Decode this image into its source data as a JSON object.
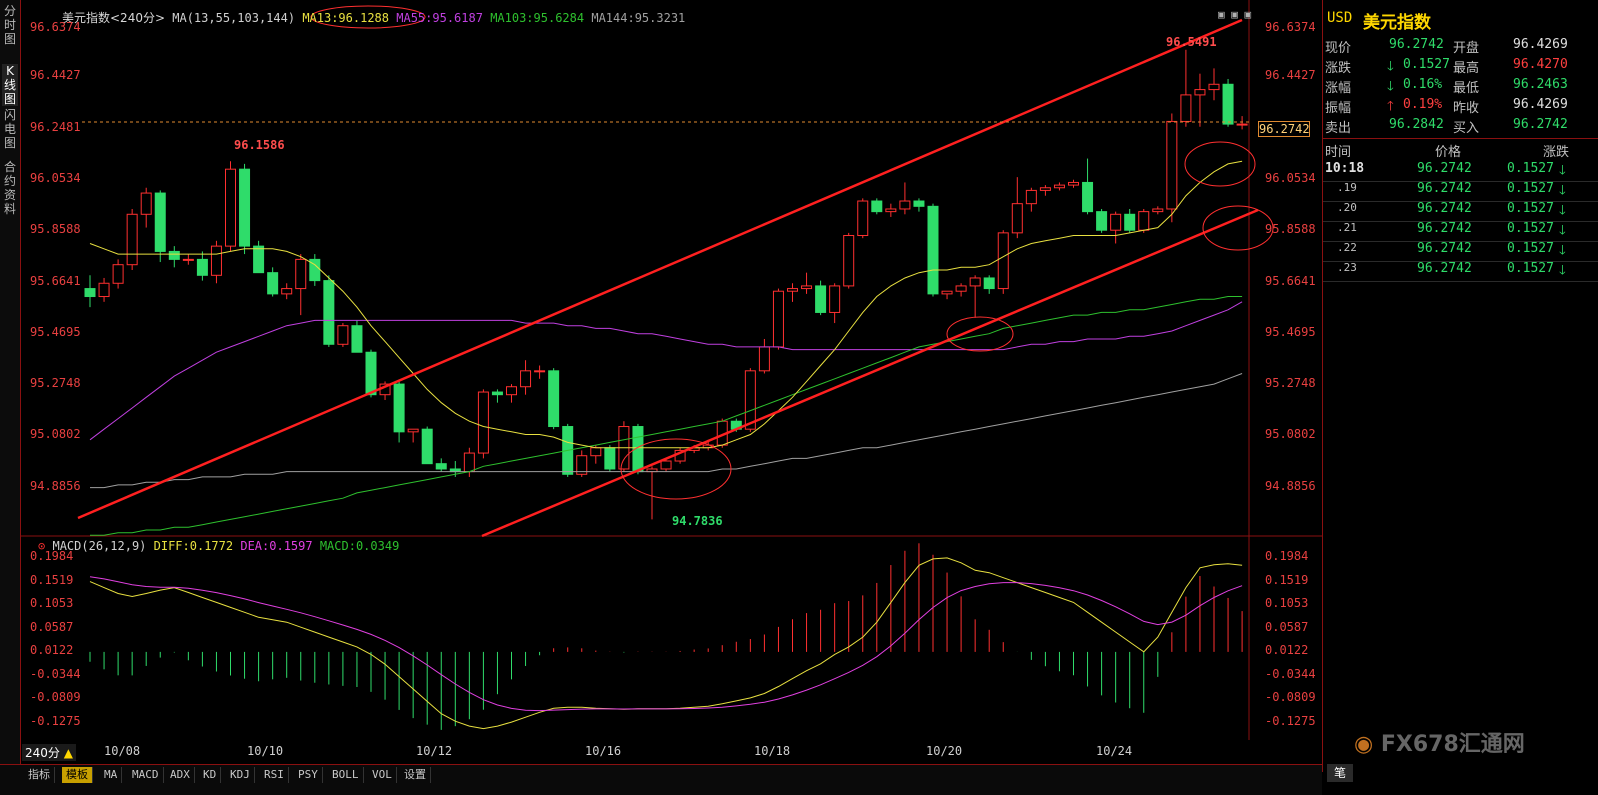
{
  "leftbar": {
    "tabs": [
      {
        "label": "分时图",
        "active": false
      },
      {
        "label": "K线图",
        "active": true
      },
      {
        "label": "闪电图",
        "active": false
      },
      {
        "label": "合约资料",
        "active": false
      }
    ]
  },
  "main_legend": {
    "title": "美元指数<240分>",
    "ma_params": "MA(13,55,103,144)",
    "ma13": "MA13:96.1288",
    "ma55": "MA55:95.6187",
    "ma103": "MA103:95.6284",
    "ma144": "MA144:95.3231"
  },
  "macd_legend": {
    "params": "MACD(26,12,9)",
    "diff": "DIFF:0.1772",
    "dea": "DEA:0.1597",
    "macd": "MACD:0.0349"
  },
  "price_axis": [
    "96.6374",
    "96.4427",
    "96.2481",
    "96.0534",
    "95.8588",
    "95.6641",
    "95.4695",
    "95.2748",
    "95.0802",
    "94.8856"
  ],
  "macd_axis": [
    "0.1984",
    "0.1519",
    "0.1053",
    "0.0587",
    "0.0122",
    "-0.0344",
    "-0.0809",
    "-0.1275"
  ],
  "x_axis": [
    "10/08",
    "10/10",
    "10/12",
    "10/16",
    "10/18",
    "10/20",
    "10/24"
  ],
  "annotations": {
    "high_label": "96.5491",
    "left_high_label": "96.1586",
    "low_label": "94.7836",
    "current_price_tag": "96.2742"
  },
  "period_selector": "240分",
  "bottom_tabs": [
    "指标",
    "模板",
    "MA",
    "MACD",
    "ADX",
    "KD",
    "KDJ",
    "RSI",
    "PSY",
    "BOLL",
    "VOL",
    "设置"
  ],
  "quote_panel": {
    "symbol": "USD",
    "name": "美元指数",
    "rows": [
      {
        "l1": "现价",
        "v1": "96.2742",
        "l2": "开盘",
        "v2": "96.4269"
      },
      {
        "l1": "涨跌",
        "v1": "0.1527",
        "l2": "最高",
        "v2": "96.4270"
      },
      {
        "l1": "涨幅",
        "v1": "0.16%",
        "l2": "最低",
        "v2": "96.2463"
      },
      {
        "l1": "振幅",
        "v1": "0.19%",
        "l2": "昨收",
        "v2": "96.4269"
      },
      {
        "l1": "卖出",
        "v1": "96.2842",
        "l2": "买入",
        "v2": "96.2742"
      }
    ],
    "ticks_header": {
      "time": "时间",
      "price": "价格",
      "change": "涨跌"
    },
    "ticks": [
      {
        "time": "10:18",
        "price": "96.2742",
        "change": "0.1527"
      },
      {
        "time": ".19",
        "price": "96.2742",
        "change": "0.1527"
      },
      {
        "time": ".20",
        "price": "96.2742",
        "change": "0.1527"
      },
      {
        "time": ".21",
        "price": "96.2742",
        "change": "0.1527"
      },
      {
        "time": ".22",
        "price": "96.2742",
        "change": "0.1527"
      },
      {
        "time": ".23",
        "price": "96.2742",
        "change": "0.1527"
      }
    ],
    "bottom_tab": "笔"
  },
  "watermark": "FX678汇通网",
  "colors": {
    "up": "#ff3030",
    "down": "#2fdc6a",
    "ma13": "#e8e040",
    "ma55": "#2ec02e",
    "ma103": "#c040e0",
    "ma144": "#a0a0a0",
    "trend": "#ff2020"
  },
  "chart_data": {
    "type": "candlestick",
    "ylim": [
      94.74,
      96.7
    ],
    "candles": [
      [
        95.65,
        95.7,
        95.58,
        95.62
      ],
      [
        95.62,
        95.69,
        95.6,
        95.67
      ],
      [
        95.67,
        95.76,
        95.65,
        95.74
      ],
      [
        95.74,
        95.95,
        95.72,
        95.93
      ],
      [
        95.93,
        96.03,
        95.88,
        96.01
      ],
      [
        96.01,
        96.02,
        95.75,
        95.79
      ],
      [
        95.79,
        95.81,
        95.73,
        95.76
      ],
      [
        95.76,
        95.78,
        95.74,
        95.76
      ],
      [
        95.76,
        95.79,
        95.68,
        95.7
      ],
      [
        95.7,
        95.83,
        95.67,
        95.81
      ],
      [
        95.81,
        96.13,
        95.79,
        96.1
      ],
      [
        96.1,
        96.12,
        95.78,
        95.81
      ],
      [
        95.81,
        95.83,
        95.71,
        95.71
      ],
      [
        95.71,
        95.73,
        95.62,
        95.63
      ],
      [
        95.63,
        95.67,
        95.61,
        95.65
      ],
      [
        95.65,
        95.78,
        95.55,
        95.76
      ],
      [
        95.76,
        95.78,
        95.66,
        95.68
      ],
      [
        95.68,
        95.7,
        95.43,
        95.44
      ],
      [
        95.44,
        95.52,
        95.43,
        95.51
      ],
      [
        95.51,
        95.53,
        95.41,
        95.41
      ],
      [
        95.41,
        95.42,
        95.24,
        95.25
      ],
      [
        95.25,
        95.3,
        95.23,
        95.29
      ],
      [
        95.29,
        95.3,
        95.07,
        95.11
      ],
      [
        95.11,
        95.12,
        95.07,
        95.12
      ],
      [
        95.12,
        95.13,
        94.99,
        94.99
      ],
      [
        94.99,
        95.01,
        94.96,
        94.97
      ],
      [
        94.97,
        95.0,
        94.94,
        94.96
      ],
      [
        94.96,
        95.05,
        94.94,
        95.03
      ],
      [
        95.03,
        95.27,
        95.01,
        95.26
      ],
      [
        95.26,
        95.27,
        95.22,
        95.25
      ],
      [
        95.25,
        95.29,
        95.22,
        95.28
      ],
      [
        95.28,
        95.38,
        95.25,
        95.34
      ],
      [
        95.34,
        95.36,
        95.31,
        95.34
      ],
      [
        95.34,
        95.35,
        95.12,
        95.13
      ],
      [
        95.13,
        95.14,
        94.94,
        94.95
      ],
      [
        94.95,
        95.04,
        94.94,
        95.02
      ],
      [
        95.02,
        95.06,
        94.99,
        95.05
      ],
      [
        95.05,
        95.06,
        94.96,
        94.97
      ],
      [
        94.97,
        95.15,
        94.96,
        95.13
      ],
      [
        95.13,
        95.14,
        94.95,
        94.96
      ],
      [
        94.96,
        94.98,
        94.78,
        94.97
      ],
      [
        94.97,
        95.01,
        94.96,
        95.0
      ],
      [
        95.0,
        95.05,
        94.99,
        95.04
      ],
      [
        95.04,
        95.06,
        95.03,
        95.05
      ],
      [
        95.05,
        95.08,
        95.04,
        95.06
      ],
      [
        95.06,
        95.16,
        95.05,
        95.15
      ],
      [
        95.15,
        95.16,
        95.11,
        95.12
      ],
      [
        95.12,
        95.35,
        95.11,
        95.34
      ],
      [
        95.34,
        95.46,
        95.33,
        95.43
      ],
      [
        95.43,
        95.65,
        95.42,
        95.64
      ],
      [
        95.64,
        95.67,
        95.6,
        95.65
      ],
      [
        95.65,
        95.71,
        95.63,
        95.66
      ],
      [
        95.66,
        95.68,
        95.55,
        95.56
      ],
      [
        95.56,
        95.67,
        95.52,
        95.66
      ],
      [
        95.66,
        95.86,
        95.65,
        95.85
      ],
      [
        95.85,
        95.99,
        95.84,
        95.98
      ],
      [
        95.98,
        95.99,
        95.93,
        95.94
      ],
      [
        95.94,
        95.97,
        95.92,
        95.95
      ],
      [
        95.95,
        96.05,
        95.93,
        95.98
      ],
      [
        95.98,
        95.99,
        95.94,
        95.96
      ],
      [
        95.96,
        95.97,
        95.62,
        95.63
      ],
      [
        95.63,
        95.64,
        95.61,
        95.64
      ],
      [
        95.64,
        95.67,
        95.62,
        95.66
      ],
      [
        95.66,
        95.7,
        95.54,
        95.69
      ],
      [
        95.69,
        95.7,
        95.63,
        95.65
      ],
      [
        95.65,
        95.87,
        95.63,
        95.86
      ],
      [
        95.86,
        96.07,
        95.84,
        95.97
      ],
      [
        95.97,
        96.03,
        95.94,
        96.02
      ],
      [
        96.02,
        96.04,
        96.0,
        96.03
      ],
      [
        96.03,
        96.05,
        96.02,
        96.04
      ],
      [
        96.04,
        96.06,
        96.03,
        96.05
      ],
      [
        96.05,
        96.14,
        95.93,
        95.94
      ],
      [
        95.94,
        95.95,
        95.86,
        95.87
      ],
      [
        95.87,
        95.94,
        95.82,
        95.93
      ],
      [
        95.93,
        95.95,
        95.86,
        95.87
      ],
      [
        95.87,
        95.95,
        95.86,
        95.94
      ],
      [
        95.94,
        95.96,
        95.93,
        95.95
      ],
      [
        95.95,
        96.31,
        95.9,
        96.28
      ],
      [
        96.28,
        96.55,
        96.26,
        96.38
      ],
      [
        96.38,
        96.46,
        96.26,
        96.4
      ],
      [
        96.4,
        96.48,
        96.36,
        96.42
      ],
      [
        96.42,
        96.44,
        96.26,
        96.27
      ],
      [
        96.27,
        96.3,
        96.25,
        96.27
      ]
    ],
    "ma13": [
      95.82,
      95.8,
      95.78,
      95.78,
      95.78,
      95.78,
      95.78,
      95.78,
      95.78,
      95.78,
      95.79,
      95.8,
      95.8,
      95.8,
      95.79,
      95.77,
      95.74,
      95.69,
      95.64,
      95.58,
      95.51,
      95.45,
      95.39,
      95.33,
      95.27,
      95.22,
      95.18,
      95.15,
      95.13,
      95.12,
      95.11,
      95.1,
      95.1,
      95.09,
      95.07,
      95.06,
      95.05,
      95.05,
      95.05,
      95.05,
      95.05,
      95.05,
      95.05,
      95.05,
      95.05,
      95.06,
      95.08,
      95.1,
      95.14,
      95.19,
      95.24,
      95.3,
      95.36,
      95.42,
      95.49,
      95.56,
      95.62,
      95.66,
      95.69,
      95.71,
      95.72,
      95.72,
      95.73,
      95.73,
      95.74,
      95.77,
      95.8,
      95.82,
      95.83,
      95.84,
      95.85,
      95.85,
      95.85,
      95.85,
      95.86,
      95.87,
      95.88,
      95.93,
      96.0,
      96.05,
      96.09,
      96.12,
      96.13
    ],
    "ma55": [
      94.72,
      94.72,
      94.73,
      94.73,
      94.74,
      94.74,
      94.75,
      94.75,
      94.76,
      94.77,
      94.78,
      94.79,
      94.8,
      94.81,
      94.82,
      94.83,
      94.84,
      94.85,
      94.86,
      94.88,
      94.89,
      94.9,
      94.91,
      94.92,
      94.93,
      94.94,
      94.95,
      94.96,
      94.98,
      94.99,
      95.0,
      95.01,
      95.02,
      95.03,
      95.04,
      95.05,
      95.06,
      95.07,
      95.08,
      95.09,
      95.1,
      95.11,
      95.12,
      95.13,
      95.14,
      95.15,
      95.17,
      95.19,
      95.21,
      95.23,
      95.25,
      95.27,
      95.29,
      95.31,
      95.33,
      95.35,
      95.37,
      95.39,
      95.41,
      95.43,
      95.44,
      95.45,
      95.46,
      95.47,
      95.48,
      95.5,
      95.51,
      95.52,
      95.53,
      95.54,
      95.55,
      95.55,
      95.56,
      95.56,
      95.57,
      95.57,
      95.58,
      95.59,
      95.6,
      95.61,
      95.61,
      95.62,
      95.62
    ],
    "ma103": [
      95.08,
      95.12,
      95.16,
      95.2,
      95.24,
      95.28,
      95.32,
      95.35,
      95.38,
      95.41,
      95.43,
      95.45,
      95.47,
      95.49,
      95.51,
      95.52,
      95.53,
      95.53,
      95.53,
      95.53,
      95.53,
      95.53,
      95.53,
      95.53,
      95.53,
      95.53,
      95.53,
      95.53,
      95.53,
      95.53,
      95.53,
      95.52,
      95.52,
      95.52,
      95.51,
      95.51,
      95.5,
      95.5,
      95.49,
      95.48,
      95.48,
      95.47,
      95.46,
      95.45,
      95.44,
      95.44,
      95.43,
      95.43,
      95.43,
      95.43,
      95.42,
      95.42,
      95.42,
      95.42,
      95.42,
      95.42,
      95.42,
      95.42,
      95.42,
      95.42,
      95.42,
      95.42,
      95.42,
      95.42,
      95.42,
      95.42,
      95.43,
      95.44,
      95.44,
      95.45,
      95.45,
      95.46,
      95.46,
      95.46,
      95.47,
      95.47,
      95.48,
      95.49,
      95.51,
      95.53,
      95.55,
      95.57,
      95.6
    ],
    "ma144": [
      94.9,
      94.9,
      94.91,
      94.91,
      94.92,
      94.92,
      94.93,
      94.93,
      94.94,
      94.94,
      94.94,
      94.95,
      94.95,
      94.95,
      94.96,
      94.96,
      94.96,
      94.96,
      94.96,
      94.96,
      94.96,
      94.96,
      94.96,
      94.96,
      94.96,
      94.96,
      94.96,
      94.96,
      94.96,
      94.96,
      94.96,
      94.96,
      94.96,
      94.96,
      94.96,
      94.96,
      94.96,
      94.96,
      94.96,
      94.96,
      94.96,
      94.96,
      94.96,
      94.96,
      94.96,
      94.97,
      94.97,
      94.98,
      94.99,
      95.0,
      95.01,
      95.01,
      95.02,
      95.03,
      95.04,
      95.05,
      95.05,
      95.06,
      95.07,
      95.08,
      95.09,
      95.1,
      95.11,
      95.12,
      95.13,
      95.14,
      95.15,
      95.16,
      95.17,
      95.18,
      95.19,
      95.2,
      95.21,
      95.22,
      95.23,
      95.24,
      95.25,
      95.26,
      95.27,
      95.28,
      95.29,
      95.31,
      95.33
    ],
    "macd_ylim": [
      -0.17,
      0.21
    ],
    "diff": [
      0.142,
      0.13,
      0.118,
      0.112,
      0.118,
      0.125,
      0.13,
      0.12,
      0.11,
      0.1,
      0.09,
      0.08,
      0.07,
      0.065,
      0.06,
      0.05,
      0.04,
      0.03,
      0.02,
      0.01,
      -0.005,
      -0.025,
      -0.05,
      -0.075,
      -0.1,
      -0.125,
      -0.14,
      -0.15,
      -0.155,
      -0.15,
      -0.142,
      -0.132,
      -0.122,
      -0.114,
      -0.112,
      -0.112,
      -0.114,
      -0.115,
      -0.116,
      -0.115,
      -0.115,
      -0.115,
      -0.114,
      -0.112,
      -0.11,
      -0.105,
      -0.099,
      -0.093,
      -0.084,
      -0.07,
      -0.054,
      -0.038,
      -0.024,
      -0.005,
      0.01,
      0.03,
      0.06,
      0.1,
      0.14,
      0.175,
      0.188,
      0.19,
      0.18,
      0.165,
      0.16,
      0.15,
      0.14,
      0.13,
      0.12,
      0.11,
      0.1,
      0.08,
      0.06,
      0.04,
      0.02,
      0.0,
      0.03,
      0.08,
      0.13,
      0.17,
      0.176,
      0.178,
      0.175
    ]
  }
}
